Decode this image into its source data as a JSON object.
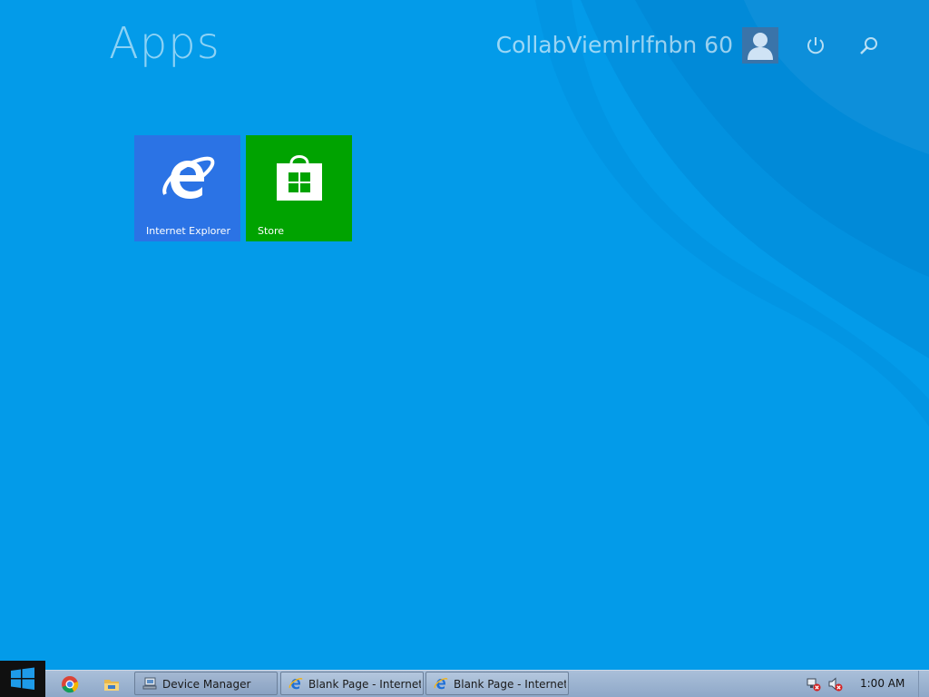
{
  "start_screen": {
    "title": "Apps",
    "user_name": "CollabViemlrlfnbn 60",
    "top_icons": [
      "user-avatar-icon",
      "power-icon",
      "search-icon"
    ]
  },
  "tiles": [
    {
      "label": "Internet Explorer",
      "icon": "internet-explorer-icon",
      "color": "#2b73e5"
    },
    {
      "label": "Store",
      "icon": "store-icon",
      "color": "#00a300"
    }
  ],
  "taskbar": {
    "start_icon": "windows-logo-icon",
    "pinned": [
      "chrome-icon",
      "file-explorer-icon"
    ],
    "tasks": [
      {
        "label": "Device Manager",
        "icon": "device-manager-icon"
      },
      {
        "label": "Blank Page - Internet...",
        "icon": "internet-explorer-icon"
      },
      {
        "label": "Blank Page - Internet...",
        "icon": "internet-explorer-icon"
      }
    ],
    "tray_icons": [
      "network-error-icon",
      "volume-muted-icon"
    ],
    "clock": "1:00 AM"
  },
  "colors": {
    "background": "#039be9",
    "ie_tile": "#2b73e5",
    "store_tile": "#00a300",
    "taskbar": "#9db4d2"
  }
}
